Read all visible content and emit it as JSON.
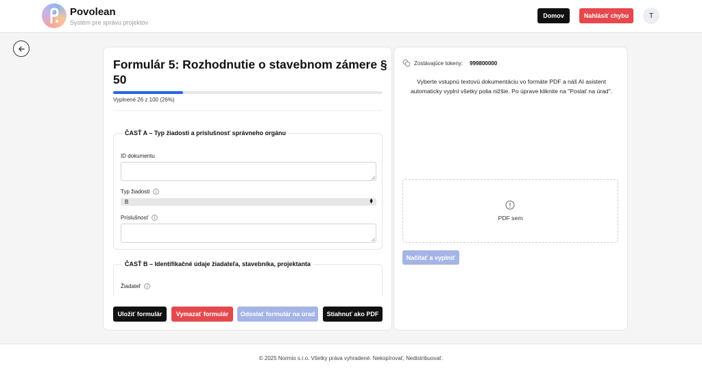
{
  "header": {
    "brand_name": "Povolean",
    "brand_sub": "Systém pre správu projektov",
    "home_label": "Domov",
    "report_label": "Nahlásiť chybu",
    "avatar_initial": "T"
  },
  "form": {
    "title": "Formulár 5: Rozhodnutie o stavebnom zámere § 50",
    "progress_text": "Vyplnené 26 z 100 (26%)",
    "progress_filled": 26,
    "progress_total": 100,
    "sections": {
      "a": {
        "legend": "ČASŤ A – Typ žiadosti a príslušnosť správneho orgánu",
        "fields": {
          "document_id_label": "ID dokumentu",
          "request_type_label": "Typ žiadosti",
          "request_type_value": "B",
          "jurisdiction_label": "Príslušnosť"
        }
      },
      "b": {
        "legend": "ČASŤ B – Identifikačné údaje žiadateľa, stavebníka, projektanta",
        "fields": {
          "applicant_label": "Žiadateľ"
        }
      }
    },
    "buttons": {
      "save": "Uložiť formulár",
      "clear": "Vymazať formulár",
      "send": "Odoslať formulár na úrad",
      "download": "Stiahnuť ako PDF"
    }
  },
  "assistant": {
    "tokens_label": "Zostávajúce tokeny:",
    "tokens_value": "999800000",
    "instructions": "Vyberte vstupnú textovú dokumentáciu vo formáte PDF a náš AI asistent automaticky vyplní všetky polia nižšie. Po úprave kliknite na \"Poslať na úrad\".",
    "dropzone_text": "PDF sem",
    "load_button": "Načítať a vyplniť"
  },
  "footer": {
    "text": "© 2025 Normio s.r.o. Všetky práva vyhradené. Nekopírovať, Nedistribuovať."
  },
  "colors": {
    "accent": "#2563eb",
    "danger": "#e5484d",
    "disabled_button": "#a5b4e6",
    "dark_button": "#111111"
  },
  "icons": {
    "back": "arrow-left-icon",
    "info": "info-circle-icon",
    "tokens": "coins-icon",
    "dropzone": "alert-circle-icon"
  }
}
